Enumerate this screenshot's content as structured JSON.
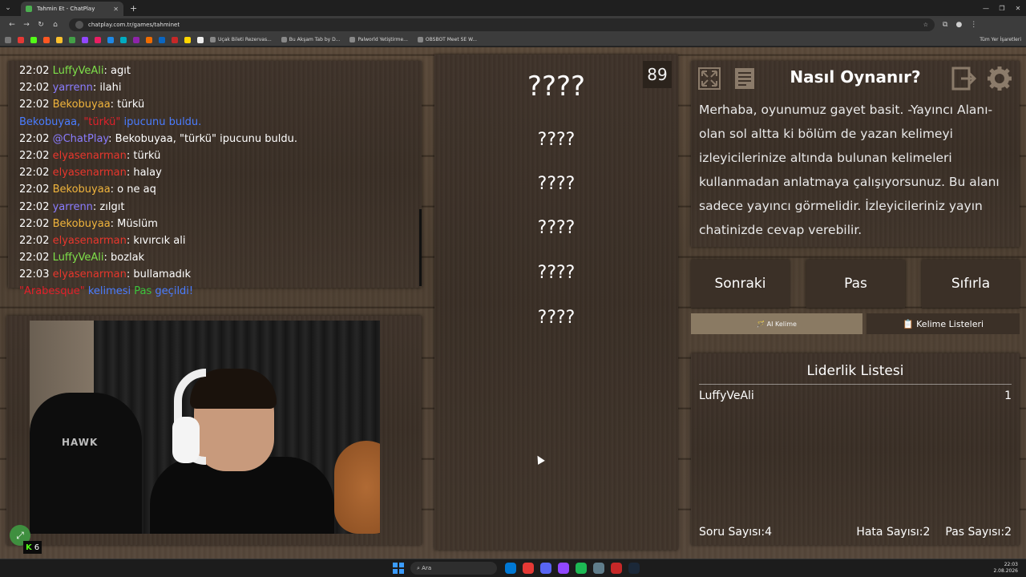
{
  "browser": {
    "tab_title": "Tahmin Et - ChatPlay",
    "url": "chatplay.com.tr/games/tahminet",
    "bookmarks": [
      "Uçak Bileti Rezervas...",
      "Bu Akşam Tab by D...",
      "Palworld Yetiştirme...",
      "OBSBOT Meet SE W..."
    ],
    "all_bookmarks": "Tüm Yer İşaretleri"
  },
  "chat": {
    "lines": [
      {
        "time": "22:02",
        "user": "LuffyVeAli",
        "color": "#7ee04a",
        "msg": ": agıt"
      },
      {
        "time": "22:02",
        "user": "yarrenn",
        "color": "#8a7cff",
        "msg": ": ilahi"
      },
      {
        "time": "22:02",
        "user": "Bekobuyaa",
        "color": "#f0b43c",
        "msg": ": türkü"
      },
      {
        "system": true,
        "parts": [
          {
            "t": "Bekobuyaa, ",
            "c": "#4a7cff"
          },
          {
            "t": "\"türkü\"",
            "c": "#e0202a"
          },
          {
            "t": " ipucunu buldu.",
            "c": "#4a7cff"
          }
        ]
      },
      {
        "time": "22:02",
        "user": "@ChatPlay",
        "color": "#8a7cff",
        "msg": ": Bekobuyaa, \"türkü\" ipucunu buldu."
      },
      {
        "time": "22:02",
        "user": "elyasenarman",
        "color": "#e8362c",
        "msg": ": türkü"
      },
      {
        "time": "22:02",
        "user": "elyasenarman",
        "color": "#e8362c",
        "msg": ": halay"
      },
      {
        "time": "22:02",
        "user": "Bekobuyaa",
        "color": "#f0b43c",
        "msg": ": o ne aq"
      },
      {
        "time": "22:02",
        "user": "yarrenn",
        "color": "#8a7cff",
        "msg": ": zılgıt"
      },
      {
        "time": "22:02",
        "user": "Bekobuyaa",
        "color": "#f0b43c",
        "msg": ": Müslüm"
      },
      {
        "time": "22:02",
        "user": "elyasenarman",
        "color": "#e8362c",
        "msg": ": kıvırcık ali"
      },
      {
        "time": "22:02",
        "user": "LuffyVeAli",
        "color": "#7ee04a",
        "msg": ": bozlak"
      },
      {
        "time": "22:03",
        "user": "elyasenarman",
        "color": "#e8362c",
        "msg": ": bullamadık"
      },
      {
        "system": true,
        "parts": [
          {
            "t": "\"Arabesque\"",
            "c": "#e0202a"
          },
          {
            "t": " kelimesi ",
            "c": "#4a7cff"
          },
          {
            "t": "Pas",
            "c": "#3cc43c"
          },
          {
            "t": " geçildi!",
            "c": "#4a7cff"
          }
        ]
      }
    ]
  },
  "game": {
    "timer": "89",
    "main_word": "????",
    "hints": [
      "????",
      "????",
      "????",
      "????",
      "????"
    ]
  },
  "howto": {
    "title": "Nasıl Oynanır?",
    "text": "Merhaba, oyunumuz gayet basit. -Yayıncı Alanı- olan sol altta ki bölüm de yazan kelimeyi izleyicilerinize altında bulunan kelimeleri kullanmadan anlatmaya çalışıyorsunuz. Bu alanı sadece yayıncı görmelidir. İzleyicileriniz yayın chatinizde cevap verebilir."
  },
  "controls": {
    "next": "Sonraki",
    "pass": "Pas",
    "reset": "Sıfırla",
    "ai_word": "🪄 AI Kelime",
    "word_lists": "📋 Kelime Listeleri"
  },
  "leaderboard": {
    "title": "Liderlik Listesi",
    "entries": [
      {
        "name": "LuffyVeAli",
        "score": "1"
      }
    ],
    "question_count": "Soru Sayısı:4",
    "error_count": "Hata Sayısı:2",
    "pass_count": "Pas Sayısı:2"
  },
  "kick": {
    "count": "6"
  },
  "taskbar": {
    "search": "Ara",
    "time": "22:03",
    "date": "2.08.2026"
  }
}
